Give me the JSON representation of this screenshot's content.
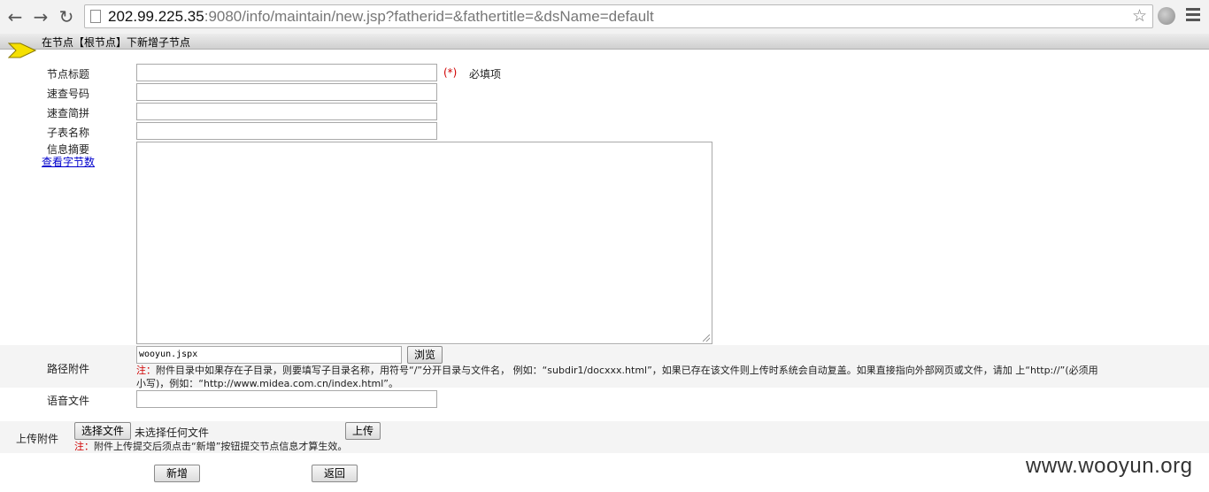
{
  "browser": {
    "url_host": "202.99.225.35",
    "url_rest": ":9080/info/maintain/new.jsp?fatherid=&fathertitle=&dsName=default"
  },
  "header": {
    "crumb": "在节点【根节点】下新增子节点"
  },
  "form": {
    "title_label": "节点标题",
    "required_mark": "(*)",
    "required_text": "必填项",
    "quick_code_label": "速查号码",
    "quick_pinyin_label": "速查简拼",
    "subtable_label": "子表名称",
    "summary_label": "信息摘要",
    "count_link": "查看字节数",
    "path_label": "路径附件",
    "path_value": "wooyun.jspx",
    "browse_button": "浏览",
    "path_note_mark": "注：",
    "path_note_line1": "附件目录中如果存在子目录，则要填写子目录名称，用符号“/”分开目录与文件名， 例如：“subdir1/docxxx.html”，如果已存在该文件则上传时系统会自动复盖。如果直接指向外部网页或文件，请加 上“http://”(必须用",
    "path_note_line2": "小写)，例如：“http://www.midea.com.cn/index.html”。",
    "voice_label": "语音文件",
    "upload_label": "上传附件",
    "choose_file_button": "选择文件",
    "no_file_text": "未选择任何文件",
    "upload_button": "上传",
    "upload_note_mark": "注：",
    "upload_note": "附件上传提交后须点击“新增”按钮提交节点信息才算生效。",
    "add_button": "新增",
    "back_button": "返回"
  },
  "watermark": "www.wooyun.org"
}
